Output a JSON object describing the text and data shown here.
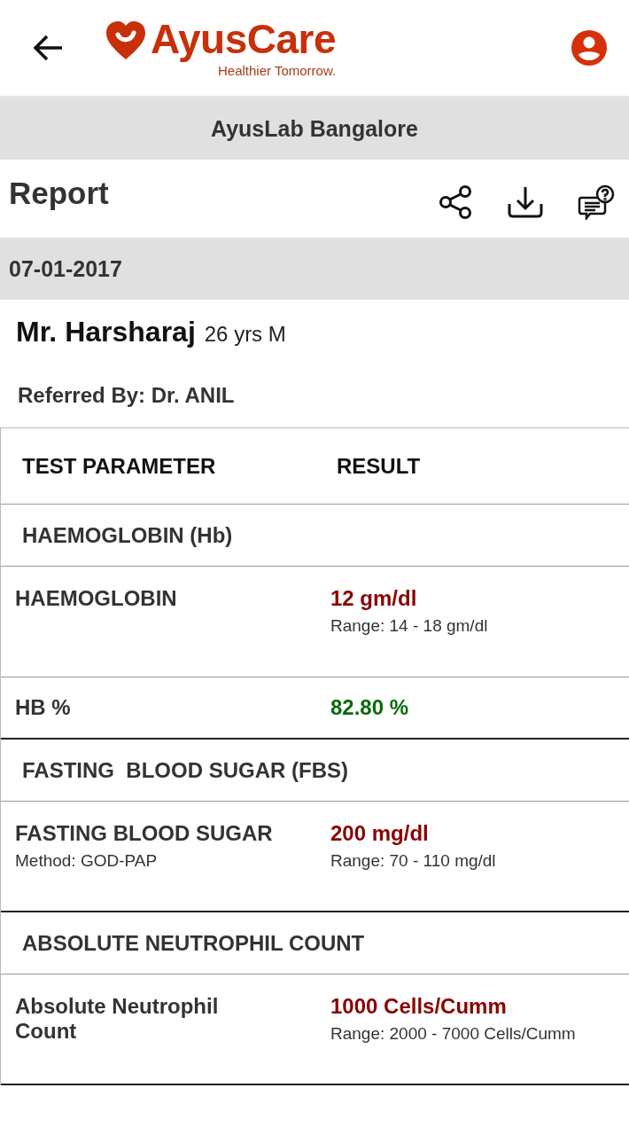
{
  "header": {
    "brand": "AyusCare",
    "tagline": "Healthier Tomorrow."
  },
  "lab": "AyusLab Bangalore",
  "report": {
    "title": "Report"
  },
  "date": "07-01-2017",
  "patient": {
    "name": "Mr. Harsharaj",
    "details": "26 yrs M",
    "referred_by": "Referred By: Dr. ANIL"
  },
  "table": {
    "columns": [
      "TEST PARAMETER",
      "RESULT"
    ],
    "groups": [
      {
        "title": "HAEMOGLOBIN (Hb)",
        "rows": [
          {
            "name": "HAEMOGLOBIN",
            "result": "12 gm/dl",
            "range": "Range: 14 - 18 gm/dl",
            "abnormal": true
          },
          {
            "name": "HB %",
            "result": "82.80 %",
            "abnormal": false
          }
        ]
      },
      {
        "title": "FASTING  BLOOD SUGAR (FBS)",
        "rows": [
          {
            "name": "FASTING BLOOD SUGAR",
            "method": "Method: GOD-PAP",
            "result": "200 mg/dl",
            "range": "Range: 70 - 110 mg/dl",
            "abnormal": true
          }
        ]
      },
      {
        "title": "ABSOLUTE NEUTROPHIL COUNT",
        "rows": [
          {
            "name": "Absolute Neutrophil Count",
            "result": "1000 Cells/Cumm",
            "range": "Range: 2000 - 7000 Cells/Cumm",
            "abnormal": true
          }
        ]
      }
    ]
  }
}
